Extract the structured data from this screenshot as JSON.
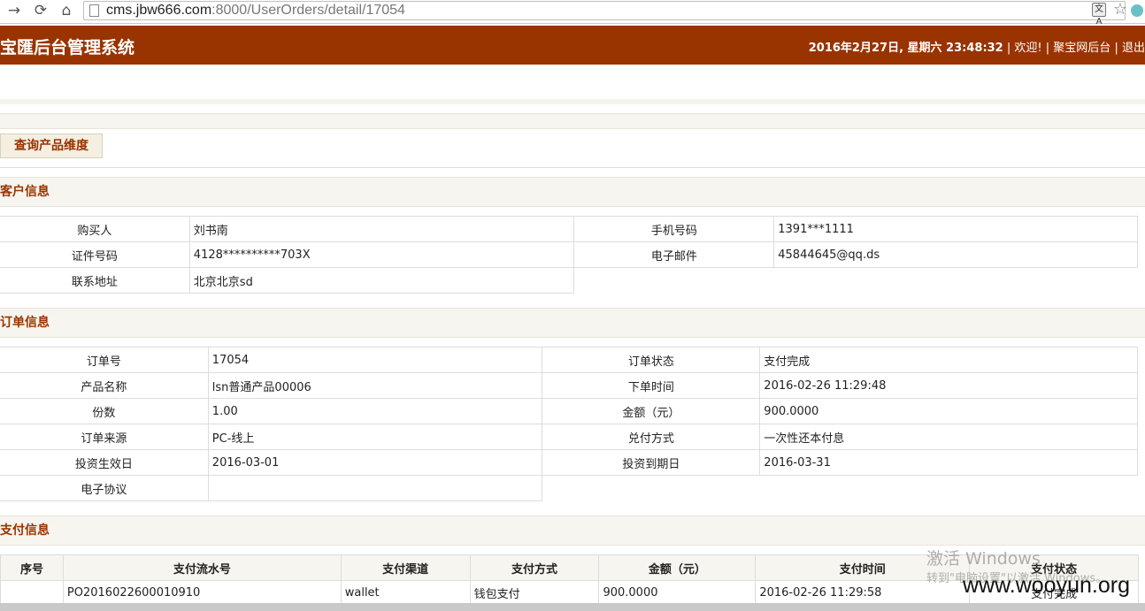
{
  "browser": {
    "url_host": "cms.jbw666.com",
    "url_rest": ":8000/UserOrders/detail/17054",
    "translate_glyph": "文A"
  },
  "header": {
    "title": "宝匯后台管理系统",
    "datetime": "2016年2月27日, 星期六 23:48:32",
    "sep": "|",
    "welcome": "欢迎!",
    "backend_link": "聚宝网后台",
    "logout": "退出"
  },
  "toolbar": {
    "query_button": "查询产品维度"
  },
  "customer": {
    "heading": "客户信息",
    "buyer_label": "购买人",
    "buyer": "刘书南",
    "phone_label": "手机号码",
    "phone": "1391***1111",
    "id_label": "证件号码",
    "id": "4128**********703X",
    "email_label": "电子邮件",
    "email": "45844645@qq.ds",
    "address_label": "联系地址",
    "address": "北京北京sd"
  },
  "order": {
    "heading": "订单信息",
    "no_label": "订单号",
    "no": "17054",
    "status_label": "订单状态",
    "status": "支付完成",
    "product_label": "产品名称",
    "product": "lsn普通产品00006",
    "order_time_label": "下单时间",
    "order_time": "2016-02-26 11:29:48",
    "shares_label": "份数",
    "shares": "1.00",
    "amount_label": "金额（元）",
    "amount": "900.0000",
    "source_label": "订单来源",
    "source": "PC-线上",
    "redeem_label": "兑付方式",
    "redeem": "一次性还本付息",
    "start_label": "投资生效日",
    "start": "2016-03-01",
    "end_label": "投资到期日",
    "end": "2016-03-31",
    "agreement_label": "电子协议",
    "agreement": ""
  },
  "payment": {
    "heading": "支付信息",
    "columns": [
      "序号",
      "支付流水号",
      "支付渠道",
      "支付方式",
      "金额（元）",
      "支付时间",
      "支付状态"
    ],
    "rows": [
      {
        "seq": "",
        "serial": "PO2016022600010910",
        "channel": "wallet",
        "method": "钱包支付",
        "amount": "900.0000",
        "time": "2016-02-26 11:29:58",
        "status": "支付完成"
      }
    ]
  },
  "overlay": {
    "activate": "激活 Windows",
    "activate_hint": "转到\"电脑设置\"以激活 Windows。",
    "site": "www.wooyun.org"
  }
}
